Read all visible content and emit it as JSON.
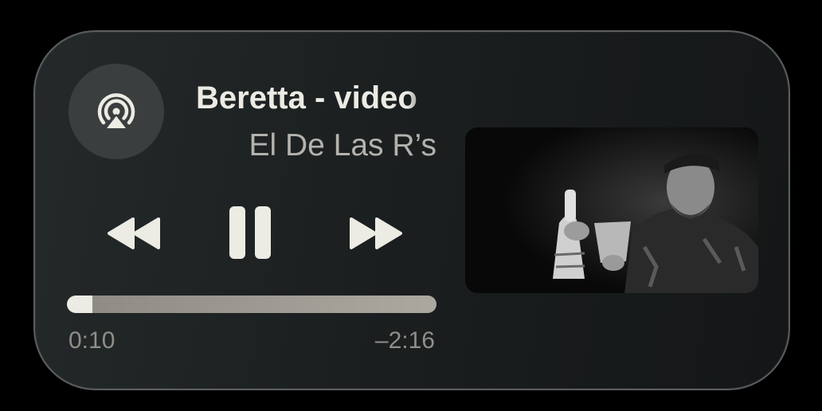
{
  "player": {
    "title": "Beretta - video",
    "artist": "El De Las R’s",
    "elapsed": "0:10",
    "remaining": "–2:16",
    "progress_fraction": 0.07
  },
  "icons": {
    "airplay": "airplay-audio-icon",
    "rewind": "rewind-icon",
    "pause": "pause-icon",
    "forward": "fast-forward-icon"
  },
  "colors": {
    "background": "#000000",
    "widget": "#1b1f20",
    "icon": "#ecebe4",
    "track": "#a09e96",
    "secondary_text": "#b3b2ad"
  }
}
